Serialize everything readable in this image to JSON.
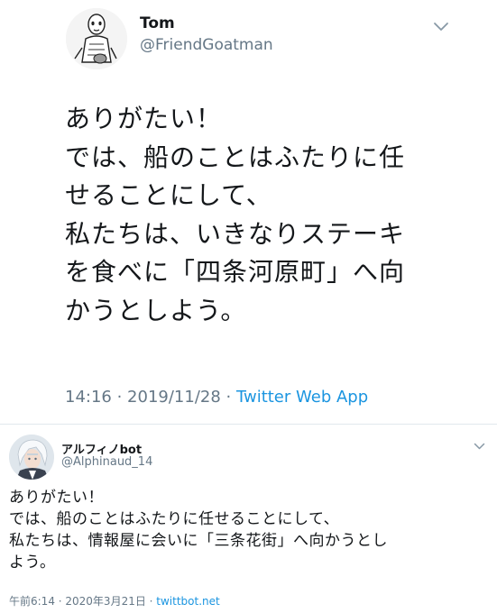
{
  "tweet1": {
    "user": {
      "name": "Tom",
      "handle": "@FriendGoatman"
    },
    "text_lines": [
      "ありがたい！",
      "では、船のことはふたりに任",
      "せることにして、",
      "私たちは、いきなりステーキ",
      "を食べに「四条河原町」へ向",
      "かうとしよう。"
    ],
    "meta": {
      "time_date": "14:16 · 2019/11/28 · ",
      "source": "Twitter Web App"
    }
  },
  "tweet2": {
    "user": {
      "name": "アルフィノbot",
      "handle": "@Alphinaud_14"
    },
    "text_lines": [
      "ありがたい！",
      "では、船のことはふたりに任せることにして、",
      "私たちは、情報屋に会いに「三条花街」へ向かうとし",
      "よう。"
    ],
    "meta": {
      "time_date": "午前6:14 · 2020年3月21日 · ",
      "source": "twittbot.net"
    }
  },
  "colors": {
    "text": "#14171a",
    "secondary": "#657786",
    "link": "#1b95e0",
    "divider": "#e1e8ed"
  },
  "icons": {
    "tweet_menu": "chevron-down-icon"
  }
}
